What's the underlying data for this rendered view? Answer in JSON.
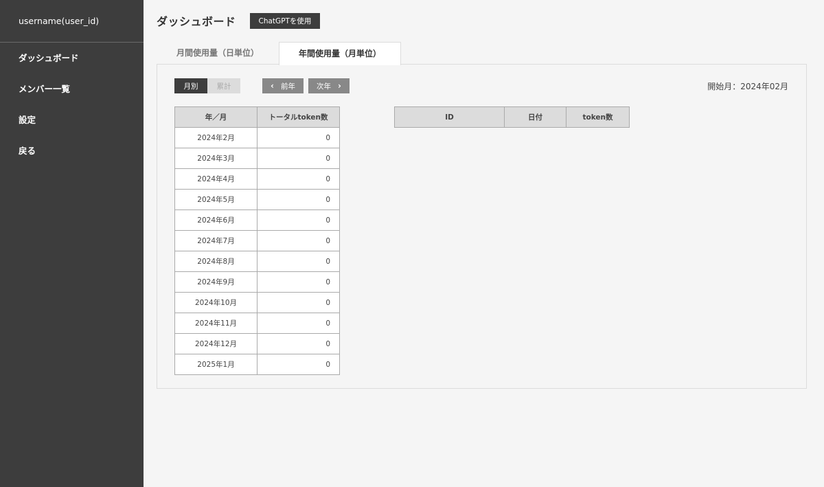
{
  "sidebar": {
    "username": "username(user_id)",
    "items": [
      {
        "label": "ダッシュボード"
      },
      {
        "label": "メンバー一覧"
      },
      {
        "label": "設定"
      },
      {
        "label": "戻る"
      }
    ]
  },
  "header": {
    "title": "ダッシュボード",
    "chatgpt_button": "ChatGPTを使用"
  },
  "tabs": [
    {
      "label": "月間使用量（日単位）",
      "active": false
    },
    {
      "label": "年間使用量（月単位）",
      "active": true
    }
  ],
  "toolbar": {
    "toggle_monthly": "月別",
    "toggle_cumulative": "累計",
    "prev_year": "前年",
    "next_year": "次年",
    "prev_arrow": "‹",
    "next_arrow": "›",
    "start_month": "開始月：2024年02月"
  },
  "month_table": {
    "headers": [
      "年／月",
      "トータルtoken数"
    ],
    "rows": [
      {
        "month": "2024年2月",
        "tokens": "0"
      },
      {
        "month": "2024年3月",
        "tokens": "0"
      },
      {
        "month": "2024年4月",
        "tokens": "0"
      },
      {
        "month": "2024年5月",
        "tokens": "0"
      },
      {
        "month": "2024年6月",
        "tokens": "0"
      },
      {
        "month": "2024年7月",
        "tokens": "0"
      },
      {
        "month": "2024年8月",
        "tokens": "0"
      },
      {
        "month": "2024年9月",
        "tokens": "0"
      },
      {
        "month": "2024年10月",
        "tokens": "0"
      },
      {
        "month": "2024年11月",
        "tokens": "0"
      },
      {
        "month": "2024年12月",
        "tokens": "0"
      },
      {
        "month": "2025年1月",
        "tokens": "0"
      }
    ]
  },
  "detail_table": {
    "headers": [
      "ID",
      "日付",
      "token数"
    ]
  }
}
